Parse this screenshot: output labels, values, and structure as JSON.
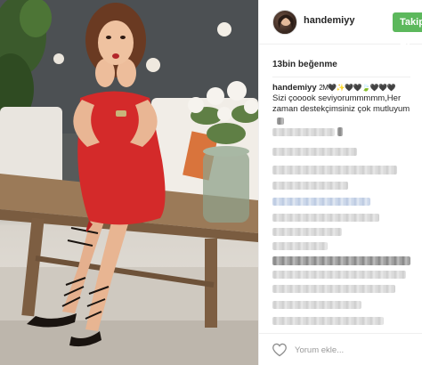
{
  "post": {
    "username": "handemiyy",
    "follow_label": "Takip Et",
    "likes_text": "13bin beğenme",
    "caption": {
      "user": "handemiyy",
      "emoji_text": "2M🖤✨🖤🖤🍃🖤🖤🖤",
      "text": "Sizi çooook seviyorummmmm,Her zaman destekçimsiniz çok mutluyum"
    },
    "comment_placeholder": "Yorum ekle..."
  },
  "icons": {
    "heart": "heart-outline-icon",
    "avatar": "profile-avatar"
  },
  "colors": {
    "follow_button": "#5cb85c",
    "dress": "#d42a2a",
    "text": "#262626",
    "muted": "#999999"
  }
}
